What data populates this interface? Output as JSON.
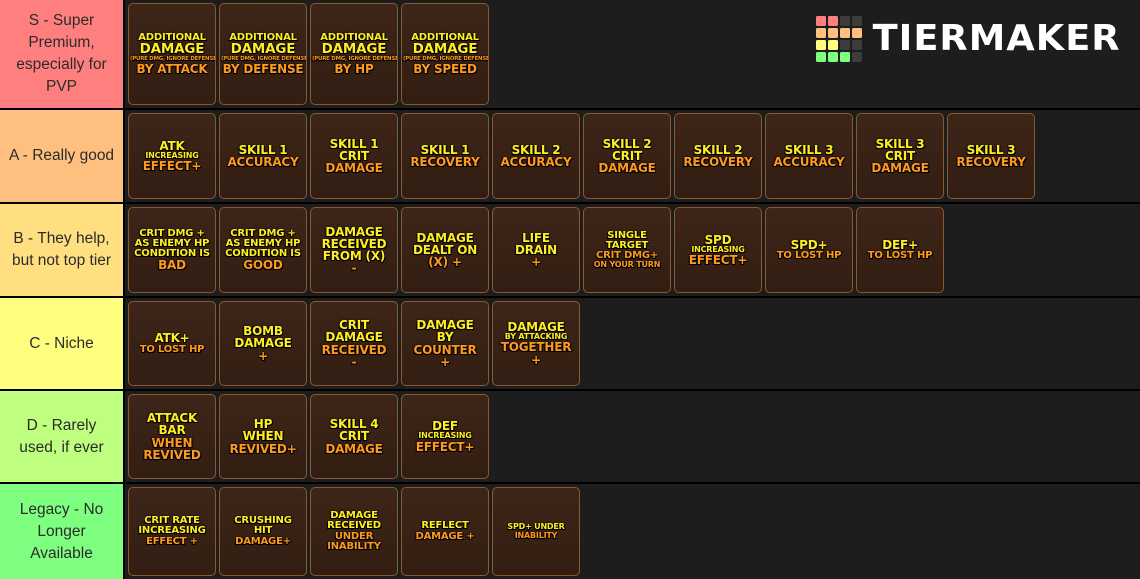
{
  "branding": {
    "name": "TIERMAKER",
    "logo_colors": [
      "#ff7f7f",
      "#ff7f7f",
      "#3d3d3d",
      "#3d3d3d",
      "#ffbf7f",
      "#ffbf7f",
      "#ffbf7f",
      "#ffbf7f",
      "#ffff7f",
      "#ffff7f",
      "#3d3d3d",
      "#3d3d3d",
      "#7fff7f",
      "#7fff7f",
      "#7fff7f",
      "#3d3d3d"
    ]
  },
  "palette": {
    "tier_s": "#ff7f7f",
    "tier_a": "#ffbf7f",
    "tier_b": "#ffdf80",
    "tier_c": "#ffff7f",
    "tier_d": "#bfff7f",
    "tier_legacy": "#7fff7f",
    "card_bg": "#3a2317",
    "card_border": "#8a5a2e",
    "text_yellow": "#ffee22",
    "text_orange": "#ff9a1e",
    "background": "#1a1a1a"
  },
  "tiers": [
    {
      "label": "S - Super Premium, especially for PVP",
      "color": "#ff7f7f",
      "cards": [
        {
          "lines": [
            {
              "text": "ADDITIONAL",
              "color": "y",
              "size": "sz-sm"
            },
            {
              "text": "DAMAGE",
              "color": "y",
              "size": "sz-lg"
            },
            {
              "text": "(PURE DMG, IGNORE DEFENSE)",
              "color": "o",
              "size": "sz-xxs"
            },
            {
              "text": "BY ATTACK",
              "color": "o",
              "size": "sz-md"
            }
          ]
        },
        {
          "lines": [
            {
              "text": "ADDITIONAL",
              "color": "y",
              "size": "sz-sm"
            },
            {
              "text": "DAMAGE",
              "color": "y",
              "size": "sz-lg"
            },
            {
              "text": "(PURE DMG, IGNORE DEFENSE)",
              "color": "o",
              "size": "sz-xxs"
            },
            {
              "text": "BY DEFENSE",
              "color": "o",
              "size": "sz-md"
            }
          ]
        },
        {
          "lines": [
            {
              "text": "ADDITIONAL",
              "color": "y",
              "size": "sz-sm"
            },
            {
              "text": "DAMAGE",
              "color": "y",
              "size": "sz-lg"
            },
            {
              "text": "(PURE DMG, IGNORE DEFENSE)",
              "color": "o",
              "size": "sz-xxs"
            },
            {
              "text": "BY HP",
              "color": "o",
              "size": "sz-md"
            }
          ]
        },
        {
          "lines": [
            {
              "text": "ADDITIONAL",
              "color": "y",
              "size": "sz-sm"
            },
            {
              "text": "DAMAGE",
              "color": "y",
              "size": "sz-lg"
            },
            {
              "text": "(PURE DMG, IGNORE DEFENSE)",
              "color": "o",
              "size": "sz-xxs"
            },
            {
              "text": "BY SPEED",
              "color": "o",
              "size": "sz-md"
            }
          ]
        }
      ]
    },
    {
      "label": "A - Really good",
      "color": "#ffbf7f",
      "cards": [
        {
          "lines": [
            {
              "text": "ATK",
              "color": "y",
              "size": "sz-md"
            },
            {
              "text": "INCREASING",
              "color": "y",
              "size": "sz-xs"
            },
            {
              "text": "EFFECT+",
              "color": "o",
              "size": "sz-md"
            }
          ]
        },
        {
          "lines": [
            {
              "text": "SKILL 1",
              "color": "y",
              "size": "sz-md"
            },
            {
              "text": "ACCURACY",
              "color": "o",
              "size": "sz-md"
            }
          ]
        },
        {
          "lines": [
            {
              "text": "SKILL 1",
              "color": "y",
              "size": "sz-md"
            },
            {
              "text": "CRIT",
              "color": "y",
              "size": "sz-md"
            },
            {
              "text": "DAMAGE",
              "color": "o",
              "size": "sz-md"
            }
          ]
        },
        {
          "lines": [
            {
              "text": "SKILL 1",
              "color": "y",
              "size": "sz-md"
            },
            {
              "text": "RECOVERY",
              "color": "o",
              "size": "sz-md"
            }
          ]
        },
        {
          "lines": [
            {
              "text": "SKILL 2",
              "color": "y",
              "size": "sz-md"
            },
            {
              "text": "ACCURACY",
              "color": "o",
              "size": "sz-md"
            }
          ]
        },
        {
          "lines": [
            {
              "text": "SKILL 2",
              "color": "y",
              "size": "sz-md"
            },
            {
              "text": "CRIT",
              "color": "y",
              "size": "sz-md"
            },
            {
              "text": "DAMAGE",
              "color": "o",
              "size": "sz-md"
            }
          ]
        },
        {
          "lines": [
            {
              "text": "SKILL 2",
              "color": "y",
              "size": "sz-md"
            },
            {
              "text": "RECOVERY",
              "color": "o",
              "size": "sz-md"
            }
          ]
        },
        {
          "lines": [
            {
              "text": "SKILL 3",
              "color": "y",
              "size": "sz-md"
            },
            {
              "text": "ACCURACY",
              "color": "o",
              "size": "sz-md"
            }
          ]
        },
        {
          "lines": [
            {
              "text": "SKILL 3",
              "color": "y",
              "size": "sz-md"
            },
            {
              "text": "CRIT",
              "color": "y",
              "size": "sz-md"
            },
            {
              "text": "DAMAGE",
              "color": "o",
              "size": "sz-md"
            }
          ]
        },
        {
          "lines": [
            {
              "text": "SKILL 3",
              "color": "y",
              "size": "sz-md"
            },
            {
              "text": "RECOVERY",
              "color": "o",
              "size": "sz-md"
            }
          ]
        }
      ]
    },
    {
      "label": "B - They help, but not top tier",
      "color": "#ffdf80",
      "cards": [
        {
          "lines": [
            {
              "text": "CRIT DMG +",
              "color": "y",
              "size": "sz-sm"
            },
            {
              "text": "AS ENEMY HP",
              "color": "y",
              "size": "sz-sm"
            },
            {
              "text": "CONDITION IS",
              "color": "y",
              "size": "sz-sm"
            },
            {
              "text": "BAD",
              "color": "o",
              "size": "sz-md"
            }
          ]
        },
        {
          "lines": [
            {
              "text": "CRIT DMG +",
              "color": "y",
              "size": "sz-sm"
            },
            {
              "text": "AS ENEMY HP",
              "color": "y",
              "size": "sz-sm"
            },
            {
              "text": "CONDITION IS",
              "color": "y",
              "size": "sz-sm"
            },
            {
              "text": "GOOD",
              "color": "o",
              "size": "sz-md"
            }
          ]
        },
        {
          "lines": [
            {
              "text": "DAMAGE",
              "color": "y",
              "size": "sz-md"
            },
            {
              "text": "RECEIVED",
              "color": "y",
              "size": "sz-md"
            },
            {
              "text": "FROM (X)",
              "color": "y",
              "size": "sz-md"
            },
            {
              "text": "-",
              "color": "o",
              "size": "sz-plus"
            }
          ]
        },
        {
          "lines": [
            {
              "text": "DAMAGE",
              "color": "y",
              "size": "sz-md"
            },
            {
              "text": "DEALT ON",
              "color": "y",
              "size": "sz-md"
            },
            {
              "text": "(X) +",
              "color": "o",
              "size": "sz-md"
            }
          ]
        },
        {
          "lines": [
            {
              "text": "LIFE",
              "color": "y",
              "size": "sz-md"
            },
            {
              "text": "DRAIN",
              "color": "y",
              "size": "sz-md"
            },
            {
              "text": "+",
              "color": "o",
              "size": "sz-plus"
            }
          ]
        },
        {
          "lines": [
            {
              "text": "SINGLE",
              "color": "y",
              "size": "sz-sm"
            },
            {
              "text": "TARGET",
              "color": "y",
              "size": "sz-sm"
            },
            {
              "text": "CRIT DMG+",
              "color": "o",
              "size": "sz-sm"
            },
            {
              "text": "ON YOUR TURN",
              "color": "o",
              "size": "sz-xs"
            }
          ]
        },
        {
          "lines": [
            {
              "text": "SPD",
              "color": "y",
              "size": "sz-md"
            },
            {
              "text": "INCREASING",
              "color": "y",
              "size": "sz-xs"
            },
            {
              "text": "EFFECT+",
              "color": "o",
              "size": "sz-md"
            }
          ]
        },
        {
          "lines": [
            {
              "text": "SPD+",
              "color": "y",
              "size": "sz-md"
            },
            {
              "text": "TO LOST HP",
              "color": "o",
              "size": "sz-sm"
            }
          ]
        },
        {
          "lines": [
            {
              "text": "DEF+",
              "color": "y",
              "size": "sz-md"
            },
            {
              "text": "TO LOST HP",
              "color": "o",
              "size": "sz-sm"
            }
          ]
        }
      ]
    },
    {
      "label": "C - Niche",
      "color": "#ffff7f",
      "cards": [
        {
          "lines": [
            {
              "text": "ATK+",
              "color": "y",
              "size": "sz-md"
            },
            {
              "text": "TO LOST HP",
              "color": "o",
              "size": "sz-sm"
            }
          ]
        },
        {
          "lines": [
            {
              "text": "BOMB",
              "color": "y",
              "size": "sz-md"
            },
            {
              "text": "DAMAGE",
              "color": "y",
              "size": "sz-md"
            },
            {
              "text": "+",
              "color": "o",
              "size": "sz-plus"
            }
          ]
        },
        {
          "lines": [
            {
              "text": "CRIT",
              "color": "y",
              "size": "sz-md"
            },
            {
              "text": "DAMAGE",
              "color": "y",
              "size": "sz-md"
            },
            {
              "text": "RECEIVED",
              "color": "o",
              "size": "sz-md"
            },
            {
              "text": "-",
              "color": "o",
              "size": "sz-plus"
            }
          ]
        },
        {
          "lines": [
            {
              "text": "DAMAGE",
              "color": "y",
              "size": "sz-md"
            },
            {
              "text": "BY",
              "color": "y",
              "size": "sz-md"
            },
            {
              "text": "COUNTER",
              "color": "o",
              "size": "sz-md"
            },
            {
              "text": "+",
              "color": "o",
              "size": "sz-plus"
            }
          ]
        },
        {
          "lines": [
            {
              "text": "DAMAGE",
              "color": "y",
              "size": "sz-md"
            },
            {
              "text": "BY ATTACKING",
              "color": "y",
              "size": "sz-xs"
            },
            {
              "text": "TOGETHER",
              "color": "o",
              "size": "sz-md"
            },
            {
              "text": "+",
              "color": "o",
              "size": "sz-plus"
            }
          ]
        }
      ]
    },
    {
      "label": "D - Rarely used, if ever",
      "color": "#bfff7f",
      "cards": [
        {
          "lines": [
            {
              "text": "ATTACK",
              "color": "y",
              "size": "sz-md"
            },
            {
              "text": "BAR",
              "color": "y",
              "size": "sz-md"
            },
            {
              "text": "WHEN",
              "color": "o",
              "size": "sz-md"
            },
            {
              "text": "REVIVED",
              "color": "o",
              "size": "sz-md"
            }
          ]
        },
        {
          "lines": [
            {
              "text": "HP",
              "color": "y",
              "size": "sz-md"
            },
            {
              "text": "WHEN",
              "color": "y",
              "size": "sz-md"
            },
            {
              "text": "REVIVED+",
              "color": "o",
              "size": "sz-md"
            }
          ]
        },
        {
          "lines": [
            {
              "text": "SKILL 4",
              "color": "y",
              "size": "sz-md"
            },
            {
              "text": "CRIT",
              "color": "y",
              "size": "sz-md"
            },
            {
              "text": "DAMAGE",
              "color": "o",
              "size": "sz-md"
            }
          ]
        },
        {
          "lines": [
            {
              "text": "DEF",
              "color": "y",
              "size": "sz-md"
            },
            {
              "text": "INCREASING",
              "color": "y",
              "size": "sz-xs"
            },
            {
              "text": "EFFECT+",
              "color": "o",
              "size": "sz-md"
            }
          ]
        }
      ]
    },
    {
      "label": "Legacy - No Longer Available",
      "color": "#7fff7f",
      "cards": [
        {
          "lines": [
            {
              "text": "CRIT RATE",
              "color": "y",
              "size": "sz-sm"
            },
            {
              "text": "INCREASING",
              "color": "y",
              "size": "sz-sm"
            },
            {
              "text": "EFFECT +",
              "color": "o",
              "size": "sz-sm"
            }
          ]
        },
        {
          "lines": [
            {
              "text": "CRUSHING",
              "color": "y",
              "size": "sz-sm"
            },
            {
              "text": "HIT",
              "color": "y",
              "size": "sz-sm"
            },
            {
              "text": "DAMAGE+",
              "color": "o",
              "size": "sz-sm"
            }
          ]
        },
        {
          "lines": [
            {
              "text": "DAMAGE",
              "color": "y",
              "size": "sz-sm"
            },
            {
              "text": "RECEIVED",
              "color": "y",
              "size": "sz-sm"
            },
            {
              "text": "UNDER",
              "color": "o",
              "size": "sz-sm"
            },
            {
              "text": "INABILITY",
              "color": "o",
              "size": "sz-sm"
            }
          ]
        },
        {
          "lines": [
            {
              "text": "REFLECT",
              "color": "y",
              "size": "sz-sm"
            },
            {
              "text": "DAMAGE +",
              "color": "o",
              "size": "sz-sm"
            }
          ]
        },
        {
          "lines": [
            {
              "text": "SPD+ UNDER",
              "color": "y",
              "size": "sz-xs"
            },
            {
              "text": "INABILITY",
              "color": "o",
              "size": "sz-xs"
            }
          ]
        }
      ]
    }
  ]
}
